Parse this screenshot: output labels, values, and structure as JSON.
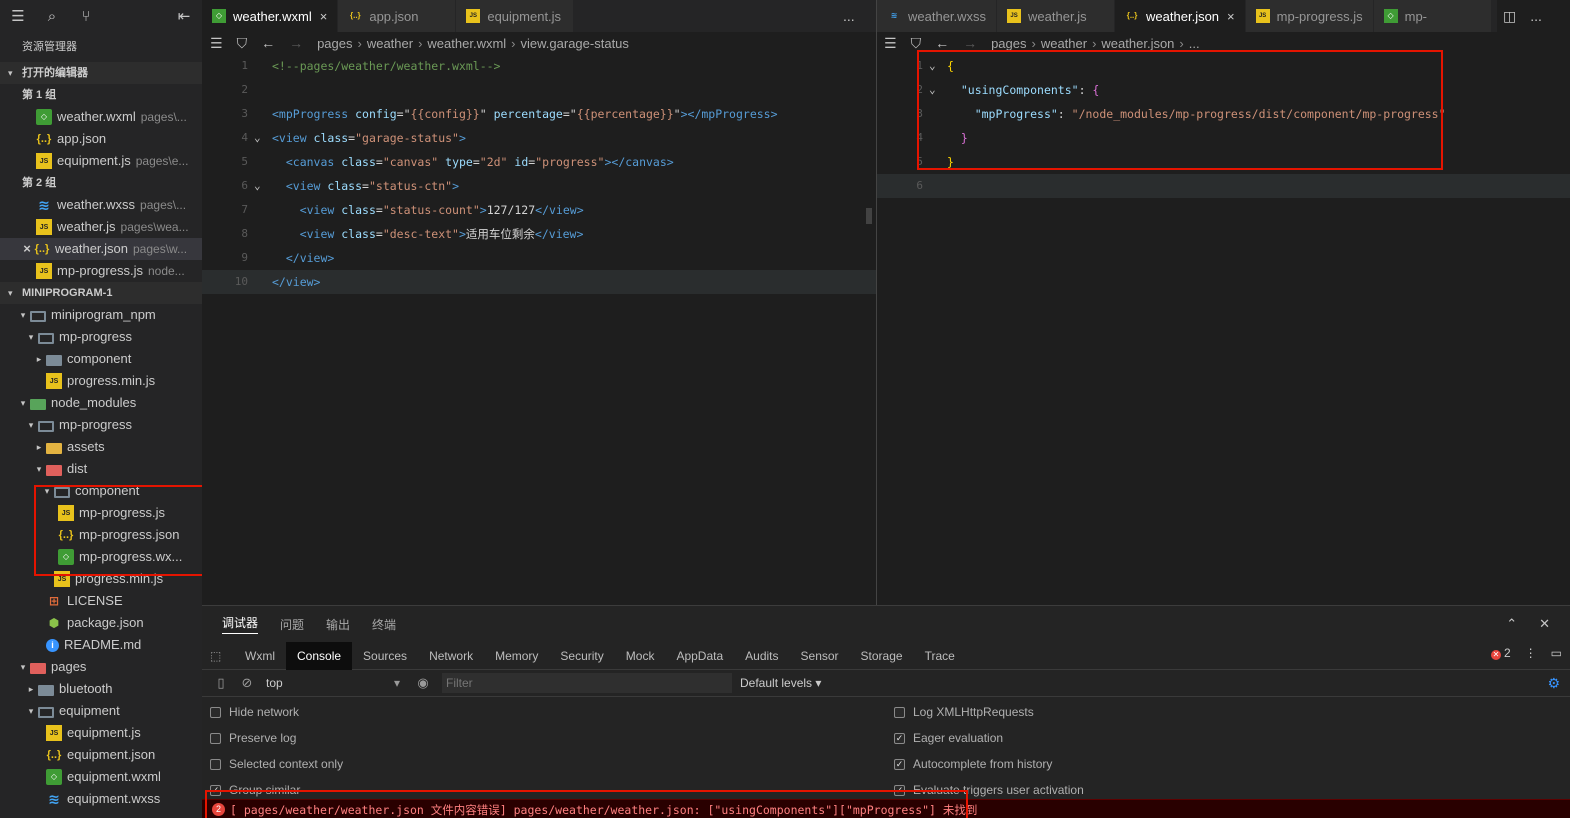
{
  "sidebar": {
    "title": "资源管理器",
    "open_editors": {
      "header": "打开的编辑器",
      "group1_label": "第 1 组",
      "group1": [
        {
          "name": "weather.wxml",
          "desc": "pages\\...",
          "icon": "wxml-file-icon"
        },
        {
          "name": "app.json",
          "desc": "",
          "icon": "json-file-icon"
        },
        {
          "name": "equipment.js",
          "desc": "pages\\e...",
          "icon": "js-file-icon"
        }
      ],
      "group2_label": "第 2 组",
      "group2": [
        {
          "name": "weather.wxss",
          "desc": "pages\\...",
          "icon": "wxss-file-icon"
        },
        {
          "name": "weather.js",
          "desc": "pages\\wea...",
          "icon": "js-file-icon"
        },
        {
          "name": "weather.json",
          "desc": "pages\\w...",
          "icon": "json-file-icon"
        },
        {
          "name": "mp-progress.js",
          "desc": "node...",
          "icon": "js-file-icon"
        }
      ]
    },
    "project": {
      "header": "MINIPROGRAM-1",
      "tree": [
        {
          "name": "miniprogram_npm",
          "depth": 1,
          "twisty": "▾",
          "icon": "folder-open"
        },
        {
          "name": "mp-progress",
          "depth": 2,
          "twisty": "▾",
          "icon": "folder-open"
        },
        {
          "name": "component",
          "depth": 3,
          "twisty": "▸",
          "icon": "folder"
        },
        {
          "name": "progress.min.js",
          "depth": 3,
          "twisty": "",
          "icon": "js"
        },
        {
          "name": "node_modules",
          "depth": 1,
          "twisty": "▾",
          "icon": "folder-g"
        },
        {
          "name": "mp-progress",
          "depth": 2,
          "twisty": "▾",
          "icon": "folder-open"
        },
        {
          "name": "assets",
          "depth": 3,
          "twisty": "▸",
          "icon": "folder-y"
        },
        {
          "name": "dist",
          "depth": 3,
          "twisty": "▾",
          "icon": "folder-r"
        },
        {
          "name": "component",
          "depth": 4,
          "twisty": "▾",
          "icon": "folder-open"
        },
        {
          "name": "mp-progress.js",
          "depth": 5,
          "twisty": "",
          "icon": "js"
        },
        {
          "name": "mp-progress.json",
          "depth": 5,
          "twisty": "",
          "icon": "json"
        },
        {
          "name": "mp-progress.wx...",
          "depth": 5,
          "twisty": "",
          "icon": "wxml"
        },
        {
          "name": "progress.min.js",
          "depth": 4,
          "twisty": "",
          "icon": "js"
        },
        {
          "name": "LICENSE",
          "depth": 3,
          "twisty": "",
          "icon": "license"
        },
        {
          "name": "package.json",
          "depth": 3,
          "twisty": "",
          "icon": "pkg"
        },
        {
          "name": "README.md",
          "depth": 3,
          "twisty": "",
          "icon": "info"
        },
        {
          "name": "pages",
          "depth": 1,
          "twisty": "▾",
          "icon": "folder-r"
        },
        {
          "name": "bluetooth",
          "depth": 2,
          "twisty": "▸",
          "icon": "folder"
        },
        {
          "name": "equipment",
          "depth": 2,
          "twisty": "▾",
          "icon": "folder-open"
        },
        {
          "name": "equipment.js",
          "depth": 3,
          "twisty": "",
          "icon": "js"
        },
        {
          "name": "equipment.json",
          "depth": 3,
          "twisty": "",
          "icon": "json"
        },
        {
          "name": "equipment.wxml",
          "depth": 3,
          "twisty": "",
          "icon": "wxml"
        },
        {
          "name": "equipment.wxss",
          "depth": 3,
          "twisty": "",
          "icon": "wxss"
        }
      ]
    }
  },
  "left_editor": {
    "tabs": [
      {
        "label": "weather.wxml",
        "icon": "wxml",
        "active": true,
        "close": "×"
      },
      {
        "label": "app.json",
        "icon": "json",
        "active": false,
        "close": ""
      },
      {
        "label": "equipment.js",
        "icon": "js",
        "active": false,
        "close": ""
      }
    ],
    "more": "...",
    "breadcrumb": [
      "pages",
      "weather",
      "weather.wxml",
      "view.garage-status"
    ],
    "lines": [
      {
        "n": "1",
        "fold": "",
        "indent": "",
        "tokens": [
          [
            "com",
            "<!--pages/weather/weather.wxml-->"
          ]
        ]
      },
      {
        "n": "2",
        "fold": "",
        "indent": "",
        "tokens": []
      },
      {
        "n": "3",
        "fold": "",
        "indent": "",
        "tokens": [
          [
            "tag",
            "<mpProgress "
          ],
          [
            "attr",
            "config"
          ],
          [
            "txt",
            "=\""
          ],
          [
            "str",
            "{{config}}"
          ],
          [
            "txt",
            "\" "
          ],
          [
            "attr",
            "percentage"
          ],
          [
            "txt",
            "=\""
          ],
          [
            "str",
            "{{percentage}}"
          ],
          [
            "txt",
            "\""
          ],
          [
            "tag",
            "></mpProgress>"
          ]
        ]
      },
      {
        "n": "4",
        "fold": "⌄",
        "indent": "",
        "tokens": [
          [
            "tag",
            "<view "
          ],
          [
            "attr",
            "class"
          ],
          [
            "txt",
            "="
          ],
          [
            "str",
            "\"garage-status\""
          ],
          [
            "tag",
            ">"
          ]
        ]
      },
      {
        "n": "5",
        "fold": "",
        "indent": "  ",
        "tokens": [
          [
            "tag",
            "<canvas "
          ],
          [
            "attr",
            "class"
          ],
          [
            "txt",
            "="
          ],
          [
            "str",
            "\"canvas\""
          ],
          [
            "txt",
            " "
          ],
          [
            "attr",
            "type"
          ],
          [
            "txt",
            "="
          ],
          [
            "str",
            "\"2d\""
          ],
          [
            "txt",
            " "
          ],
          [
            "attr",
            "id"
          ],
          [
            "txt",
            "="
          ],
          [
            "str",
            "\"progress\""
          ],
          [
            "tag",
            "></canvas>"
          ]
        ]
      },
      {
        "n": "6",
        "fold": "⌄",
        "indent": "  ",
        "tokens": [
          [
            "tag",
            "<view "
          ],
          [
            "attr",
            "class"
          ],
          [
            "txt",
            "="
          ],
          [
            "str",
            "\"status-ctn\""
          ],
          [
            "tag",
            ">"
          ]
        ]
      },
      {
        "n": "7",
        "fold": "",
        "indent": "    ",
        "tokens": [
          [
            "tag",
            "<view "
          ],
          [
            "attr",
            "class"
          ],
          [
            "txt",
            "="
          ],
          [
            "str",
            "\"status-count\""
          ],
          [
            "tag",
            ">"
          ],
          [
            "txt",
            "127/127"
          ],
          [
            "tag",
            "</view>"
          ]
        ]
      },
      {
        "n": "8",
        "fold": "",
        "indent": "    ",
        "tokens": [
          [
            "tag",
            "<view "
          ],
          [
            "attr",
            "class"
          ],
          [
            "txt",
            "="
          ],
          [
            "str",
            "\"desc-text\""
          ],
          [
            "tag",
            ">"
          ],
          [
            "txt",
            "适用车位剩余"
          ],
          [
            "tag",
            "</view>"
          ]
        ]
      },
      {
        "n": "9",
        "fold": "",
        "indent": "  ",
        "tokens": [
          [
            "tag",
            "</view>"
          ]
        ]
      },
      {
        "n": "10",
        "fold": "",
        "indent": "",
        "tokens": [
          [
            "tag",
            "</view>"
          ]
        ]
      }
    ]
  },
  "right_editor": {
    "tabs": [
      {
        "label": "weather.wxss",
        "icon": "wxss",
        "active": false,
        "close": ""
      },
      {
        "label": "weather.js",
        "icon": "js",
        "active": false,
        "close": ""
      },
      {
        "label": "weather.json",
        "icon": "json",
        "active": true,
        "close": "×"
      },
      {
        "label": "mp-progress.js",
        "icon": "js",
        "active": false,
        "close": ""
      },
      {
        "label": "mp-",
        "icon": "wxml",
        "active": false,
        "close": ""
      }
    ],
    "more": "...",
    "breadcrumb": [
      "pages",
      "weather",
      "weather.json",
      "..."
    ],
    "lines": [
      {
        "n": "1",
        "fold": "⌄",
        "indent": "",
        "tokens": [
          [
            "brace",
            "{"
          ]
        ]
      },
      {
        "n": "2",
        "fold": "⌄",
        "indent": "  ",
        "tokens": [
          [
            "key",
            "\"usingComponents\""
          ],
          [
            "txt",
            ": "
          ],
          [
            "brace2",
            "{"
          ]
        ]
      },
      {
        "n": "3",
        "fold": "",
        "indent": "    ",
        "tokens": [
          [
            "key",
            "\"mpProgress\""
          ],
          [
            "txt",
            ": "
          ],
          [
            "str",
            "\"/node_modules/mp-progress/dist/component/mp-progress\""
          ]
        ]
      },
      {
        "n": "4",
        "fold": "",
        "indent": "  ",
        "tokens": [
          [
            "brace2",
            "}"
          ]
        ]
      },
      {
        "n": "5",
        "fold": "",
        "indent": "",
        "tokens": [
          [
            "brace",
            "}"
          ]
        ]
      },
      {
        "n": "6",
        "fold": "",
        "indent": "",
        "tokens": []
      }
    ]
  },
  "panel": {
    "tabs": [
      "调试器",
      "问题",
      "输出",
      "终端"
    ],
    "devtools_tabs": [
      "Wxml",
      "Console",
      "Sources",
      "Network",
      "Memory",
      "Security",
      "Mock",
      "AppData",
      "Audits",
      "Sensor",
      "Storage",
      "Trace"
    ],
    "active_devtools_tab": "Console",
    "error_count": "2",
    "context": "top",
    "filter_placeholder": "Filter",
    "levels": "Default levels ▾",
    "left_options": [
      {
        "label": "Hide network",
        "checked": false
      },
      {
        "label": "Preserve log",
        "checked": false
      },
      {
        "label": "Selected context only",
        "checked": false
      },
      {
        "label": "Group similar",
        "checked": true
      }
    ],
    "right_options": [
      {
        "label": "Log XMLHttpRequests",
        "checked": false
      },
      {
        "label": "Eager evaluation",
        "checked": true
      },
      {
        "label": "Autocomplete from history",
        "checked": true
      },
      {
        "label": "Evaluate triggers user activation",
        "checked": true
      }
    ],
    "error_badge": "2",
    "error_message": "[ pages/weather/weather.json 文件内容错误] pages/weather/weather.json: [\"usingComponents\"][\"mpProgress\"] 未找到"
  }
}
